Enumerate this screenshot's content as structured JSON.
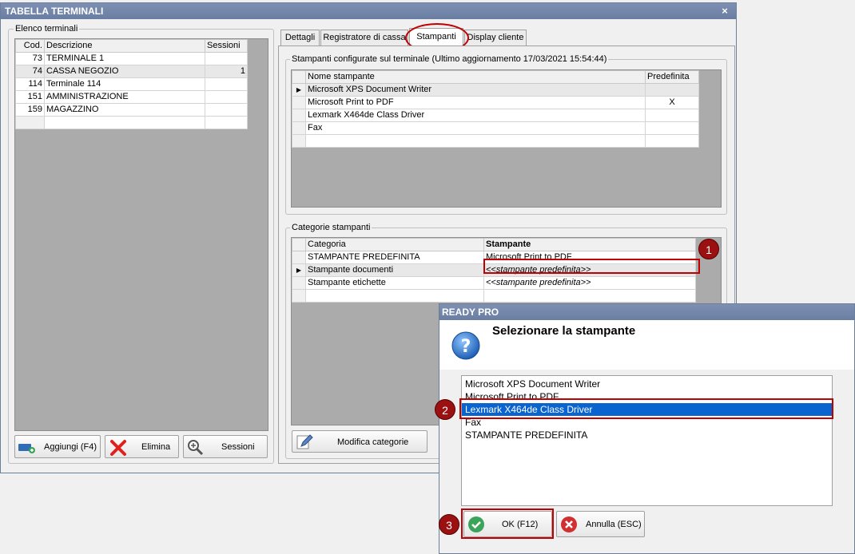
{
  "window": {
    "title": "TABELLA TERMINALI",
    "close_label": "×"
  },
  "terminals": {
    "group_label": "Elenco terminali",
    "columns": [
      "Cod.",
      "Descrizione",
      "Sessioni"
    ],
    "rows": [
      {
        "cod": "73",
        "descrizione": "TERMINALE 1",
        "sessioni": ""
      },
      {
        "cod": "74",
        "descrizione": "CASSA NEGOZIO",
        "sessioni": "1"
      },
      {
        "cod": "114",
        "descrizione": "Terminale 114",
        "sessioni": ""
      },
      {
        "cod": "151",
        "descrizione": "AMMINISTRAZIONE",
        "sessioni": ""
      },
      {
        "cod": "159",
        "descrizione": "MAGAZZINO",
        "sessioni": ""
      }
    ],
    "buttons": {
      "add": "Aggiungi (F4)",
      "delete": "Elimina",
      "sessions": "Sessioni"
    }
  },
  "tabs": [
    "Dettagli",
    "Registratore di cassa",
    "Stampanti",
    "Display cliente"
  ],
  "active_tab": "Stampanti",
  "printers": {
    "group_label": "Stampanti configurate sul terminale (Ultimo aggiornamento 17/03/2021 15:54:44)",
    "columns": [
      "Nome stampante",
      "Predefinita"
    ],
    "rows": [
      {
        "nome": "Microsoft XPS Document Writer",
        "predefinita": ""
      },
      {
        "nome": "Microsoft Print to PDF",
        "predefinita": "X"
      },
      {
        "nome": "Lexmark X464de Class Driver",
        "predefinita": ""
      },
      {
        "nome": "Fax",
        "predefinita": ""
      }
    ]
  },
  "categories": {
    "group_label": "Categorie stampanti",
    "columns": [
      "Categoria",
      "Stampante"
    ],
    "rows": [
      {
        "categoria": "STAMPANTE PREDEFINITA",
        "stampante": "Microsoft Print to PDF"
      },
      {
        "categoria": "Stampante documenti",
        "stampante": "<<stampante predefinita>>"
      },
      {
        "categoria": "Stampante etichette",
        "stampante": "<<stampante predefinita>>"
      }
    ],
    "edit_button": "Modifica categorie"
  },
  "dialog": {
    "title": "READY PRO",
    "heading": "Selezionare la stampante",
    "options": [
      "Microsoft XPS Document Writer",
      "Microsoft Print to PDF",
      "Lexmark X464de Class Driver",
      "Fax",
      "STAMPANTE PREDEFINITA"
    ],
    "selected": "Lexmark X464de Class Driver",
    "ok_label": "OK (F12)",
    "cancel_label": "Annulla (ESC)"
  },
  "badges": [
    "1",
    "2",
    "3"
  ],
  "colors": {
    "titlebar": "#6a7ea3",
    "selection": "#0a64d0",
    "highlight_red": "#c00000",
    "badge": "#9b1010",
    "ok_green": "#3aa55a",
    "cancel_red": "#d03030"
  }
}
